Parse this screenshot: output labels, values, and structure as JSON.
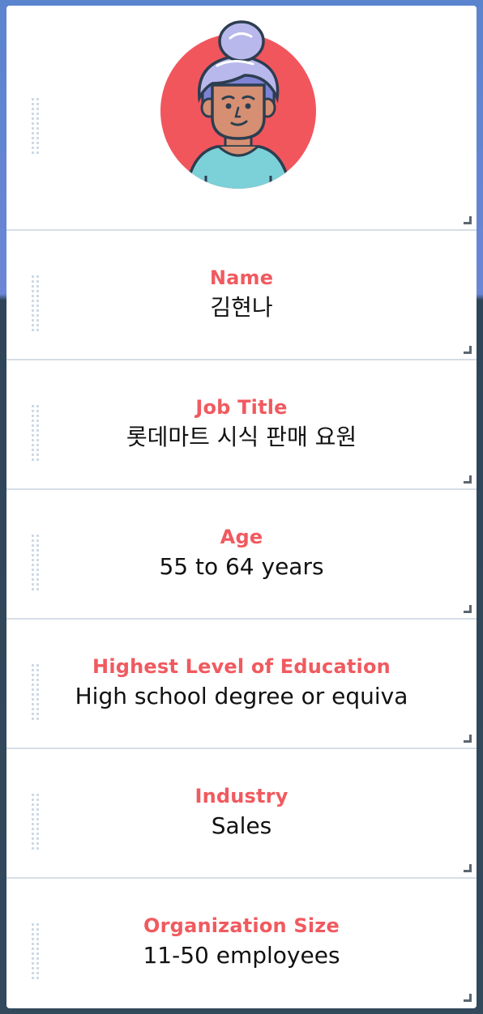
{
  "avatar": {
    "icon": "persona-avatar-icon",
    "colors": {
      "circle": "#f2565d",
      "hair": "#b9b8ec",
      "skin": "#d68f72",
      "shirt": "#7cd0d8",
      "outline": "#2c3e50"
    }
  },
  "fields": [
    {
      "label": "Name",
      "value": "김현나"
    },
    {
      "label": "Job Title",
      "value": "롯데마트 시식 판매 요원"
    },
    {
      "label": "Age",
      "value": "55 to 64 years"
    },
    {
      "label": "Highest Level of Education",
      "value": "High school degree or equiva"
    },
    {
      "label": "Industry",
      "value": "Sales"
    },
    {
      "label": "Organization Size",
      "value": "11-50 employees"
    }
  ],
  "colors": {
    "label": "#f05a5f",
    "value": "#111111",
    "divider": "#d6dee6"
  }
}
